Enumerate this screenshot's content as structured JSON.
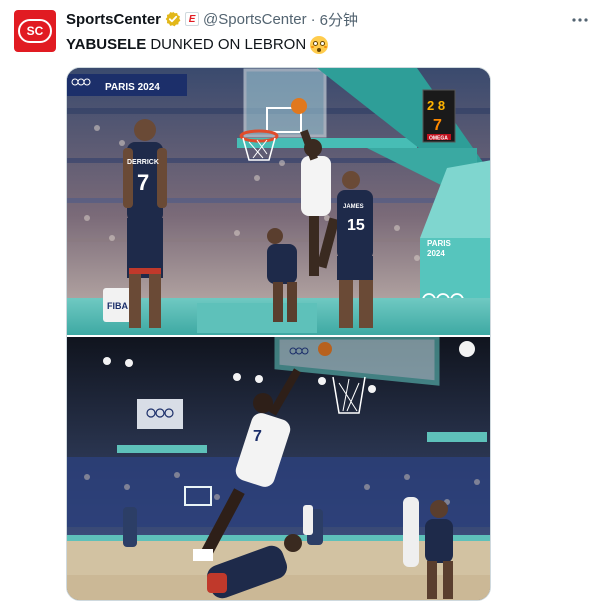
{
  "account": {
    "avatar_text": "SC",
    "display_name": "SportsCenter",
    "affiliate_badge": "E",
    "handle": "@SportsCenter",
    "separator": "·",
    "timestamp": "6分钟"
  },
  "tweet": {
    "text_bold": "YABUSELE",
    "text_rest": "DUNKED ON LEBRON"
  },
  "media": {
    "top_frame": {
      "banner": "PARIS 2024",
      "shot_clock_top": "2 8",
      "shot_clock_bottom": "7",
      "shot_clock_brand": "OMEGA",
      "stanchion_text_1": "PARIS",
      "stanchion_text_2": "2024",
      "jersey_left_name": "DERRICK",
      "jersey_left_number": "7",
      "jersey_right_name": "JAMES",
      "jersey_right_number": "15",
      "fiba": "FIBA"
    },
    "bottom_frame": {
      "jersey_number": "7"
    }
  },
  "colors": {
    "accent_red": "#e11b22",
    "muted_text": "#536471",
    "verified_gold": "#e2b719"
  }
}
